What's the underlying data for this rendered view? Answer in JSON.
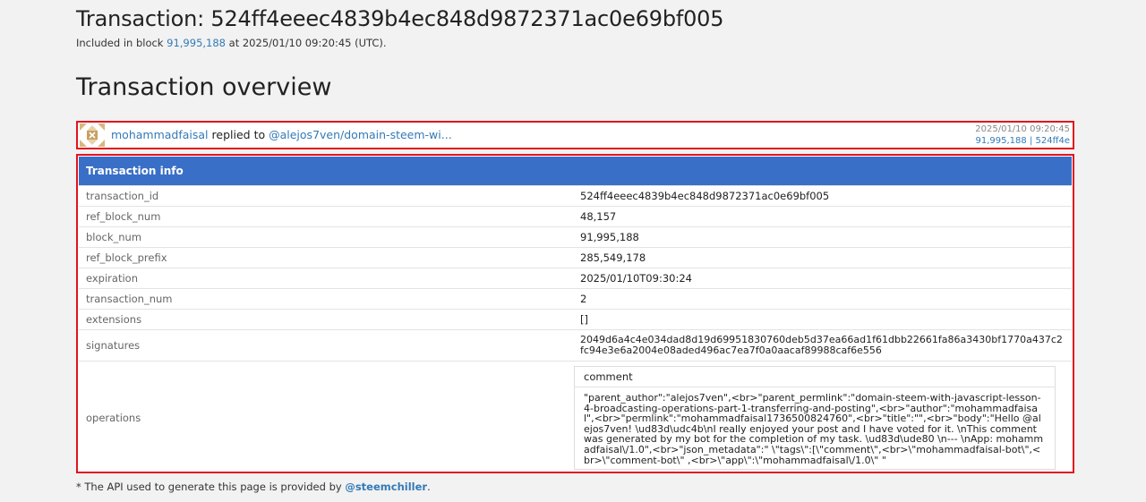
{
  "header": {
    "title": "Transaction: 524ff4eeec4839b4ec848d9872371ac0e69bf005",
    "included_prefix": "Included in block",
    "block_link": "91,995,188",
    "included_suffix": "at 2025/01/10 09:20:45 (UTC)."
  },
  "overview": {
    "title": "Transaction overview",
    "summary": {
      "author": "mohammadfaisal",
      "action": "replied to",
      "target": "@alejos7ven/domain-steem-wi...",
      "time": "2025/01/10 09:20:45",
      "block": "91,995,188",
      "separator": "|",
      "tx_short": "524ff4e"
    }
  },
  "info": {
    "heading": "Transaction info",
    "rows": [
      {
        "key": "transaction_id",
        "value": "524ff4eeec4839b4ec848d9872371ac0e69bf005"
      },
      {
        "key": "ref_block_num",
        "value": "48,157"
      },
      {
        "key": "block_num",
        "value": "91,995,188"
      },
      {
        "key": "ref_block_prefix",
        "value": "285,549,178"
      },
      {
        "key": "expiration",
        "value": "2025/01/10T09:30:24"
      },
      {
        "key": "transaction_num",
        "value": "2"
      },
      {
        "key": "extensions",
        "value": "[]"
      },
      {
        "key": "signatures",
        "value": "2049d6a4c4e034dad8d19d69951830760deb5d37ea66ad1f61dbb22661fa86a3430bf1770a437c2fc94e3e6a2004e08aded496ac7ea7f0a0aacaf89988caf6e556"
      }
    ],
    "operations": {
      "key": "operations",
      "op_type": "comment",
      "op_body": "\"parent_author\":\"alejos7ven\",<br>\"parent_permlink\":\"domain-steem-with-javascript-lesson-4-broadcasting-operations-part-1-transferring-and-posting\",<br>\"author\":\"mohammadfaisal\",<br>\"permlink\":\"mohammadfaisal1736500824760\",<br>\"title\":\"\",<br>\"body\":\"Hello @alejos7ven! \\ud83d\\udc4b\\nI really enjoyed your post and I have voted for it. \\nThis comment was generated by my bot for the completion of my task. \\ud83d\\ude80 \\n--- \\nApp: mohammadfaisal\\/1.0\",<br>\"json_metadata\":\" \\\"tags\\\":[\\\"comment\\\",<br>\\\"mohammadfaisal-bot\\\",<br>\\\"comment-bot\\\" ,<br>\\\"app\\\":\\\"mohammadfaisal\\/1.0\\\" \""
    }
  },
  "footer": {
    "prefix": "* The API used to generate this page is provided by",
    "link": "@steemchiller",
    "suffix": "."
  },
  "colors": {
    "link": "#337ab7",
    "header_blue": "#3a6fc7",
    "highlight_red": "#e0141e"
  }
}
